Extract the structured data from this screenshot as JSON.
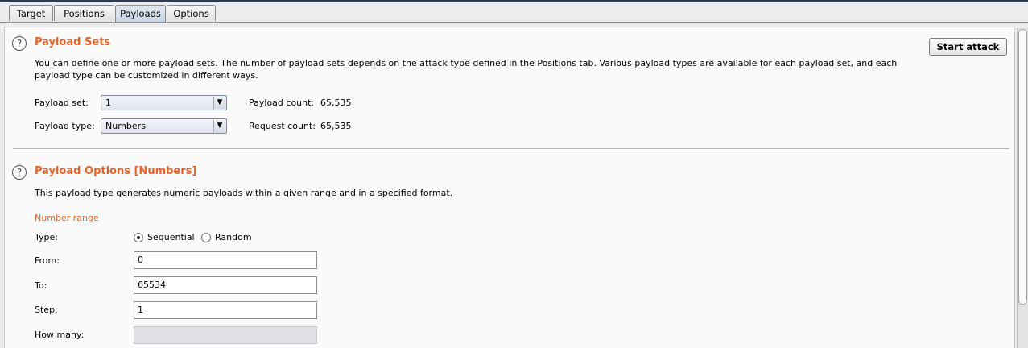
{
  "tabs": [
    {
      "label": "Target",
      "active": false
    },
    {
      "label": "Positions",
      "active": false
    },
    {
      "label": "Payloads",
      "active": true
    },
    {
      "label": "Options",
      "active": false
    }
  ],
  "payload_sets": {
    "help_glyph": "?",
    "title": "Payload Sets",
    "description_line1": "You can define one or more payload sets. The number of payload sets depends on the attack type defined in the Positions tab. Various payload types are available for each payload set, and each",
    "description_line2": "payload type can be customized in different ways.",
    "payload_set_label": "Payload set:",
    "payload_set_value": "1",
    "payload_type_label": "Payload type:",
    "payload_type_value": "Numbers",
    "payload_count_label": "Payload count:",
    "payload_count_value": "65,535",
    "request_count_label": "Request count:",
    "request_count_value": "65,535",
    "start_attack_label": "Start attack"
  },
  "payload_options": {
    "help_glyph": "?",
    "title": "Payload Options [Numbers]",
    "description": "This payload type generates numeric payloads within a given range and in a specified format.",
    "number_range_heading": "Number range",
    "type_label": "Type:",
    "type_options": [
      {
        "label": "Sequential",
        "selected": true
      },
      {
        "label": "Random",
        "selected": false
      }
    ],
    "from_label": "From:",
    "from_value": "0",
    "to_label": "To:",
    "to_value": "65534",
    "step_label": "Step:",
    "step_value": "1",
    "how_many_label": "How many:",
    "how_many_value": ""
  },
  "icons": {
    "help": "help-circle-icon",
    "dropdown": "chevron-down-icon"
  },
  "colors": {
    "section_title": "#e8652a",
    "active_tab": "#c9d5e3"
  }
}
